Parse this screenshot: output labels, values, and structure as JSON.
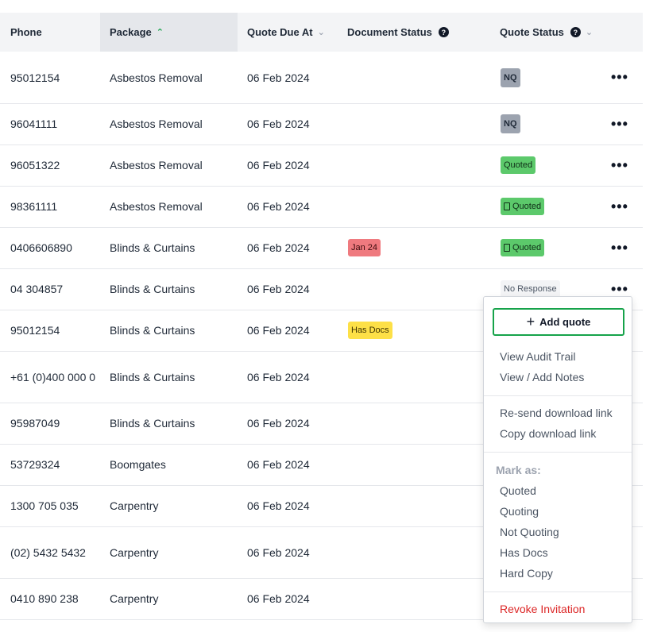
{
  "header": {
    "phone": "Phone",
    "package": "Package",
    "package_sort": "^",
    "due": "Quote Due At",
    "doc_status": "Document Status",
    "quote_status": "Quote Status",
    "help": "?",
    "sort_inactive": "⌄"
  },
  "rows": [
    {
      "phone": "95012154",
      "package": "Asbestos Removal",
      "due": "06 Feb 2024",
      "doc": "",
      "status": "NQ",
      "status_kind": "nq",
      "more": "•••"
    },
    {
      "phone": "96041111",
      "package": "Asbestos Removal",
      "due": "06 Feb 2024",
      "doc": "",
      "status": "NQ",
      "status_kind": "nq",
      "more": "•••"
    },
    {
      "phone": "96051322",
      "package": "Asbestos Removal",
      "due": "06 Feb 2024",
      "doc": "",
      "status": "Quoted",
      "status_kind": "quoted",
      "more": "•••"
    },
    {
      "phone": "98361111",
      "package": "Asbestos Removal",
      "due": "06 Feb 2024",
      "doc": "",
      "status": "Quoted",
      "status_kind": "quoted-doc",
      "more": "•••"
    },
    {
      "phone": "0406606890",
      "package": "Blinds & Curtains",
      "due": "06 Feb 2024",
      "doc": "Jan 24",
      "doc_kind": "red",
      "status": "Quoted",
      "status_kind": "quoted-doc",
      "more": "•••"
    },
    {
      "phone": "04 304857",
      "package": "Blinds & Curtains",
      "due": "06 Feb 2024",
      "doc": "",
      "status": "No Response",
      "status_kind": "noresp",
      "more": "•••"
    },
    {
      "phone": "95012154",
      "package": "Blinds & Curtains",
      "due": "06 Feb 2024",
      "doc": "Has Docs",
      "doc_kind": "yellow",
      "status": "",
      "more": ""
    },
    {
      "phone": "+61 (0)400 000 0",
      "package": "Blinds & Curtains",
      "due": "06 Feb 2024",
      "doc": "",
      "status": "",
      "more": ""
    },
    {
      "phone": "95987049",
      "package": "Blinds & Curtains",
      "due": "06 Feb 2024",
      "doc": "",
      "status": "",
      "more": ""
    },
    {
      "phone": "53729324",
      "package": "Boomgates",
      "due": "06 Feb 2024",
      "doc": "",
      "status": "",
      "more": ""
    },
    {
      "phone": "1300 705 035",
      "package": "Carpentry",
      "due": "06 Feb 2024",
      "doc": "",
      "status": "",
      "more": ""
    },
    {
      "phone": "(02) 5432 5432",
      "package": "Carpentry",
      "due": "06 Feb 2024",
      "doc": "",
      "status": "",
      "more": ""
    },
    {
      "phone": "0410 890 238",
      "package": "Carpentry",
      "due": "06 Feb 2024",
      "doc": "",
      "status": "",
      "more": ""
    }
  ],
  "menu": {
    "add_quote": "Add quote",
    "view_audit": "View Audit Trail",
    "view_notes": "View / Add Notes",
    "resend": "Re-send download link",
    "copy": "Copy download link",
    "mark_as": "Mark as:",
    "mark_items": [
      "Quoted",
      "Quoting",
      "Not Quoting",
      "Has Docs",
      "Hard Copy"
    ],
    "revoke": "Revoke Invitation"
  },
  "colors": {
    "accent": "#16a34a",
    "danger": "#dc2626",
    "quoted": "#5cc96b",
    "doc_red": "#ef7a7f",
    "doc_yellow": "#fde047"
  }
}
